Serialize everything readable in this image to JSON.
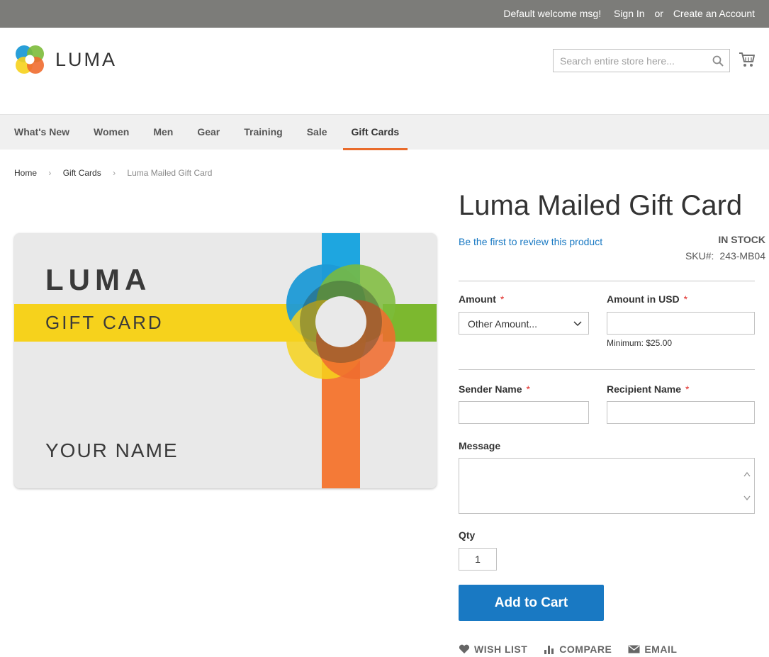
{
  "header": {
    "welcome": "Default welcome msg!",
    "sign_in": "Sign In",
    "or": "or",
    "create_account": "Create an Account",
    "logo_text": "LUMA",
    "search_placeholder": "Search entire store here..."
  },
  "nav": {
    "items": [
      "What's New",
      "Women",
      "Men",
      "Gear",
      "Training",
      "Sale",
      "Gift Cards"
    ],
    "active": "Gift Cards"
  },
  "breadcrumb": {
    "home": "Home",
    "category": "Gift Cards",
    "current": "Luma Mailed Gift Card"
  },
  "gallery": {
    "card_brand": "LUMA",
    "card_subtitle": "GIFT CARD",
    "card_name": "YOUR NAME"
  },
  "product": {
    "title": "Luma Mailed Gift Card",
    "review_link": "Be the first to review this product",
    "stock": "IN STOCK",
    "sku_label": "SKU#:",
    "sku_value": "243-MB04"
  },
  "form": {
    "amount_label": "Amount",
    "amount_selected": "Other Amount...",
    "amount_usd_label": "Amount in USD",
    "amount_usd_value": "",
    "amount_hint": "Minimum: $25.00",
    "sender_label": "Sender Name",
    "recipient_label": "Recipient Name",
    "message_label": "Message",
    "qty_label": "Qty",
    "qty_value": "1",
    "required_mark": "*"
  },
  "actions": {
    "add_to_cart": "Add to Cart",
    "wish_list": "WISH LIST",
    "compare": "COMPARE",
    "email": "EMAIL"
  },
  "colors": {
    "topbar": "#7c7c79",
    "accent_blue": "#1979c3",
    "nav_active_underline": "#e96b2b",
    "required": "#e02b27"
  }
}
